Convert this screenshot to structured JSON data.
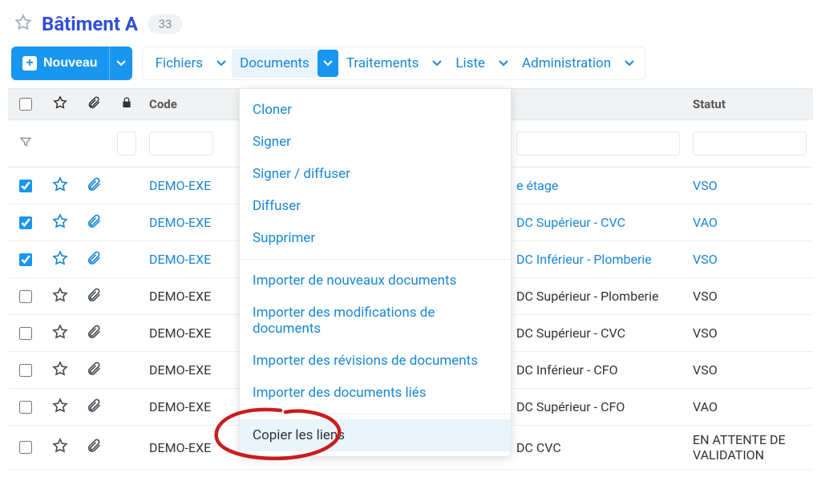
{
  "header": {
    "title": "Bâtiment A",
    "count": "33"
  },
  "toolbar": {
    "new_label": "Nouveau",
    "menus": {
      "fichiers": "Fichiers",
      "documents": "Documents",
      "traitements": "Traitements",
      "liste": "Liste",
      "administration": "Administration"
    }
  },
  "dropdown": {
    "cloner": "Cloner",
    "signer": "Signer",
    "signer_diffuser": "Signer / diffuser",
    "diffuser": "Diffuser",
    "supprimer": "Supprimer",
    "import_new": "Importer de nouveaux documents",
    "import_mod": "Importer des modifications de documents",
    "import_rev": "Importer des révisions de documents",
    "import_linked": "Importer des documents liés",
    "copier_liens": "Copier les liens"
  },
  "table": {
    "headers": {
      "code": "Code",
      "statut": "Statut"
    },
    "rows": [
      {
        "checked": true,
        "linked": true,
        "code": "DEMO-EXE",
        "mid": "e étage",
        "statut": "VSO"
      },
      {
        "checked": true,
        "linked": true,
        "code": "DEMO-EXE",
        "mid": "DC Supérieur - CVC",
        "statut": "VAO"
      },
      {
        "checked": true,
        "linked": true,
        "code": "DEMO-EXE",
        "mid": "DC Inférieur - Plomberie",
        "statut": "VSO"
      },
      {
        "checked": false,
        "linked": false,
        "code": "DEMO-EXE",
        "mid": "DC Supérieur - Plomberie",
        "statut": "VSO"
      },
      {
        "checked": false,
        "linked": false,
        "code": "DEMO-EXE",
        "mid": "DC Supérieur - CVC",
        "statut": "VSO"
      },
      {
        "checked": false,
        "linked": false,
        "code": "DEMO-EXE",
        "mid": "DC Inférieur - CFO",
        "statut": "VSO"
      },
      {
        "checked": false,
        "linked": false,
        "code": "DEMO-EXE",
        "mid": "DC Supérieur - CFO",
        "statut": "VAO"
      },
      {
        "checked": false,
        "linked": false,
        "code": "DEMO-EXE",
        "mid": "DC CVC",
        "statut": "EN ATTENTE DE VALIDATION"
      }
    ]
  }
}
